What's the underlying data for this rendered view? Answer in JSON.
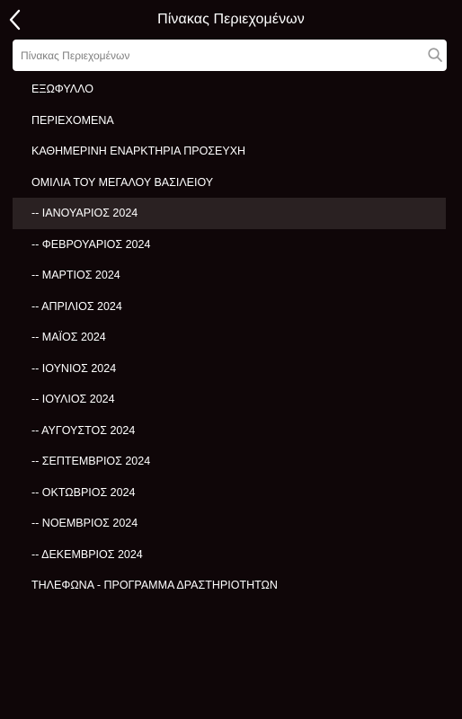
{
  "header": {
    "title": "Πίνακας Περιεχομένων",
    "back_icon": "chevron-left-icon"
  },
  "search": {
    "placeholder": "Πίνακας Περιεχομένων",
    "value": "",
    "icon": "search-icon"
  },
  "toc": {
    "selected_index": 4,
    "items": [
      {
        "label": "ΕΞΩΦΥΛΛΟ"
      },
      {
        "label": "ΠΕΡΙΕΧΟΜΕΝΑ"
      },
      {
        "label": "ΚΑΘΗΜΕΡΙΝΗ ΕΝΑΡΚΤΗΡΙΑ ΠΡΟΣΕΥΧΗ"
      },
      {
        "label": "ΟΜΙΛΙΑ ΤΟΥ ΜΕΓΑΛΟΥ ΒΑΣΙΛΕΙΟΥ"
      },
      {
        "label": "-- ΙΑΝΟΥΑΡΙΟΣ 2024"
      },
      {
        "label": "-- ΦΕΒΡΟΥΑΡΙΟΣ 2024"
      },
      {
        "label": "-- ΜΑΡΤΙΟΣ 2024"
      },
      {
        "label": "-- ΑΠΡΙΛΙΟΣ 2024"
      },
      {
        "label": "-- ΜΑΪΟΣ 2024"
      },
      {
        "label": "-- ΙΟΥΝΙΟΣ 2024"
      },
      {
        "label": "-- ΙΟΥΛΙΟΣ 2024"
      },
      {
        "label": "-- ΑΥΓΟΥΣΤΟΣ 2024"
      },
      {
        "label": "-- ΣΕΠΤΕΜΒΡΙΟΣ 2024"
      },
      {
        "label": "-- ΟΚΤΩΒΡΙΟΣ 2024"
      },
      {
        "label": "-- ΝΟΕΜΒΡΙΟΣ 2024"
      },
      {
        "label": "-- ΔΕΚΕΜΒΡΙΟΣ 2024"
      },
      {
        "label": "ΤΗΛΕΦΩΝΑ - ΠΡΟΓΡΑΜΜΑ ΔΡΑΣΤΗΡΙΟΤΗΤΩΝ"
      }
    ]
  },
  "colors": {
    "background": "#0f0608",
    "selected_row": "#2a2122",
    "text": "#ffffff"
  }
}
